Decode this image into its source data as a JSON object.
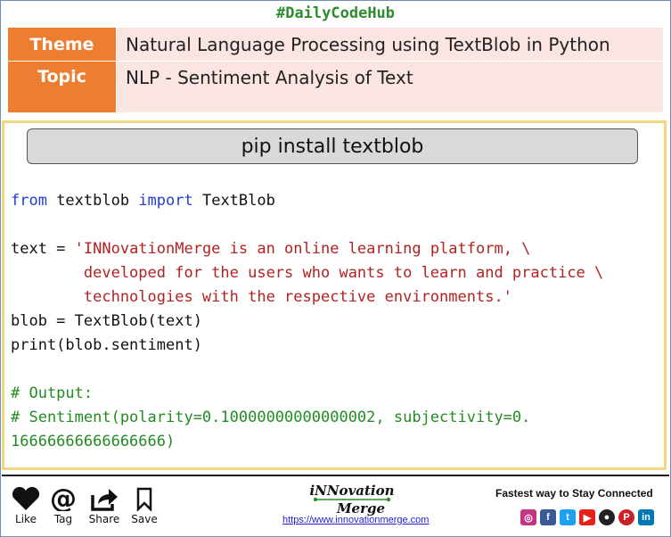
{
  "hashtag": "#DailyCodeHub",
  "header": {
    "theme_label": "Theme",
    "theme_value": "Natural Language Processing using TextBlob in Python",
    "topic_label": "Topic",
    "topic_value": "NLP - Sentiment Analysis of Text"
  },
  "install_command": "pip install textblob",
  "code": {
    "l1_kw1": "from",
    "l1_mid": " textblob ",
    "l1_kw2": "import",
    "l1_end": " TextBlob",
    "l3_pre": "text = ",
    "l3_str": "'INNovationMerge is an online learning platform, \\",
    "l4_str": "        developed for the users who wants to learn and practice \\",
    "l5_str": "        technologies with the respective environments.'",
    "l6": "blob = TextBlob(text)",
    "l7": "print(blob.sentiment)",
    "c1": "# Output:",
    "c2": "# Sentiment(polarity=0.10000000000000002, subjectivity=0.",
    "c3": "16666666666666666)"
  },
  "actions": {
    "like": "Like",
    "tag": "Tag",
    "share": "Share",
    "save": "Save"
  },
  "brand": {
    "line1": "iNNovation",
    "line2": "Merge",
    "url": "https://www.innovationmerge.com"
  },
  "tagline": "Fastest way to Stay Connected",
  "social_icons": [
    "instagram-icon",
    "facebook-icon",
    "twitter-icon",
    "youtube-icon",
    "github-icon",
    "pinterest-icon",
    "linkedin-icon"
  ],
  "colors": {
    "accent": "#ed7d31",
    "code_border": "#f2d77e",
    "keyword": "#1f3dd1",
    "string": "#b22222",
    "comment": "#228b22"
  }
}
